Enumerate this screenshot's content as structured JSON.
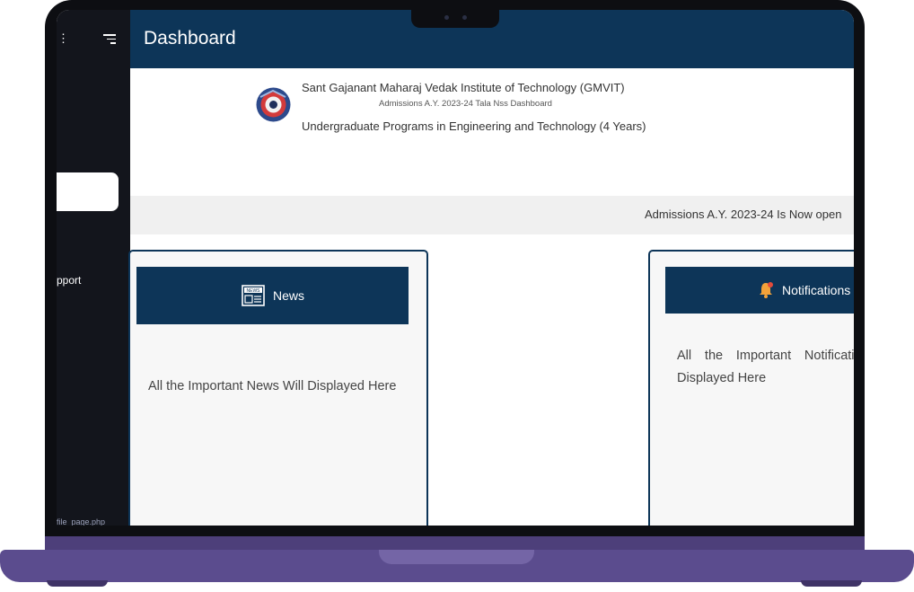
{
  "app": {
    "title": "Dashboard"
  },
  "sidebar": {
    "support_label": "pport",
    "file_label": "file_page.php"
  },
  "header": {
    "institute_name": "Sant Gajanant Maharaj Vedak Institute of Technology (GMVIT)",
    "subtitle": "Admissions A.Y. 2023-24 Tala Nss Dashboard",
    "program": "Undergraduate Programs in Engineering and Technology (4 Years)"
  },
  "marquee": {
    "text": "Admissions A.Y. 2023-24 Is Now open"
  },
  "cards": {
    "news": {
      "title": "News",
      "icon": "newspaper-icon",
      "body": "All the Important News Will Displayed Here"
    },
    "notifications": {
      "title": "Notifications",
      "icon": "bell-icon",
      "body": "All the Important Notifications Will be Displayed Here"
    }
  },
  "colors": {
    "primary": "#0d3558",
    "sidebar": "#13151c",
    "laptop_base": "#5b4c8e"
  }
}
